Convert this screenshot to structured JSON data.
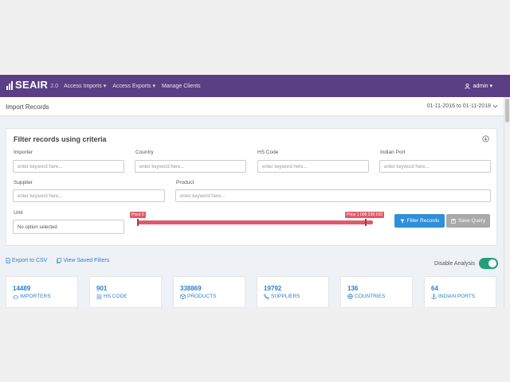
{
  "navbar": {
    "brand": "SEAIR",
    "version": "2.0",
    "links": [
      "Access Imports ▾",
      "Access Exports ▾",
      "Manage Clients"
    ],
    "user": "admin ▾"
  },
  "subheader": {
    "title": "Import Records",
    "date_range": "01-11-2016 to 01-11-2018"
  },
  "filter": {
    "title": "Filter records using criteria",
    "fields": {
      "importer": {
        "label": "Importer",
        "placeholder": "enter keyword here..."
      },
      "country": {
        "label": "Country",
        "placeholder": "enter keyword here..."
      },
      "hs_code": {
        "label": "HS Code",
        "placeholder": "enter keyword here..."
      },
      "indian_port": {
        "label": "Indian Port",
        "placeholder": "enter keyword here..."
      },
      "supplier": {
        "label": "Supplier",
        "placeholder": "enter keyword here..."
      },
      "product": {
        "label": "Product",
        "placeholder": "enter keyword here..."
      },
      "unit": {
        "label": "Unit",
        "value": "No option selected"
      }
    },
    "price_min": "Price 0",
    "price_max": "Price 1 008 239 103",
    "filter_button": "Filter Records",
    "save_button": "Save Query"
  },
  "actions": {
    "export": "Export to CSV",
    "saved_filters": "View Saved Filters",
    "analysis_label": "Disable Analysis",
    "analysis_on": true
  },
  "stats": [
    {
      "value": "14489",
      "label": "IMPORTERS",
      "icon": "cloud-icon"
    },
    {
      "value": "901",
      "label": "HS CODE",
      "icon": "list-icon"
    },
    {
      "value": "338869",
      "label": "PRODUCTS",
      "icon": "box-icon"
    },
    {
      "value": "19792",
      "label": "SUPPLIERS",
      "icon": "phone-icon"
    },
    {
      "value": "136",
      "label": "COUNTRIES",
      "icon": "globe-icon"
    },
    {
      "value": "64",
      "label": "INDIAN PORTS",
      "icon": "anchor-icon"
    }
  ],
  "colors": {
    "navbar": "#5b3f85",
    "accent": "#2f8fd8",
    "range": "#e05a6a",
    "toggle": "#22a07a"
  }
}
